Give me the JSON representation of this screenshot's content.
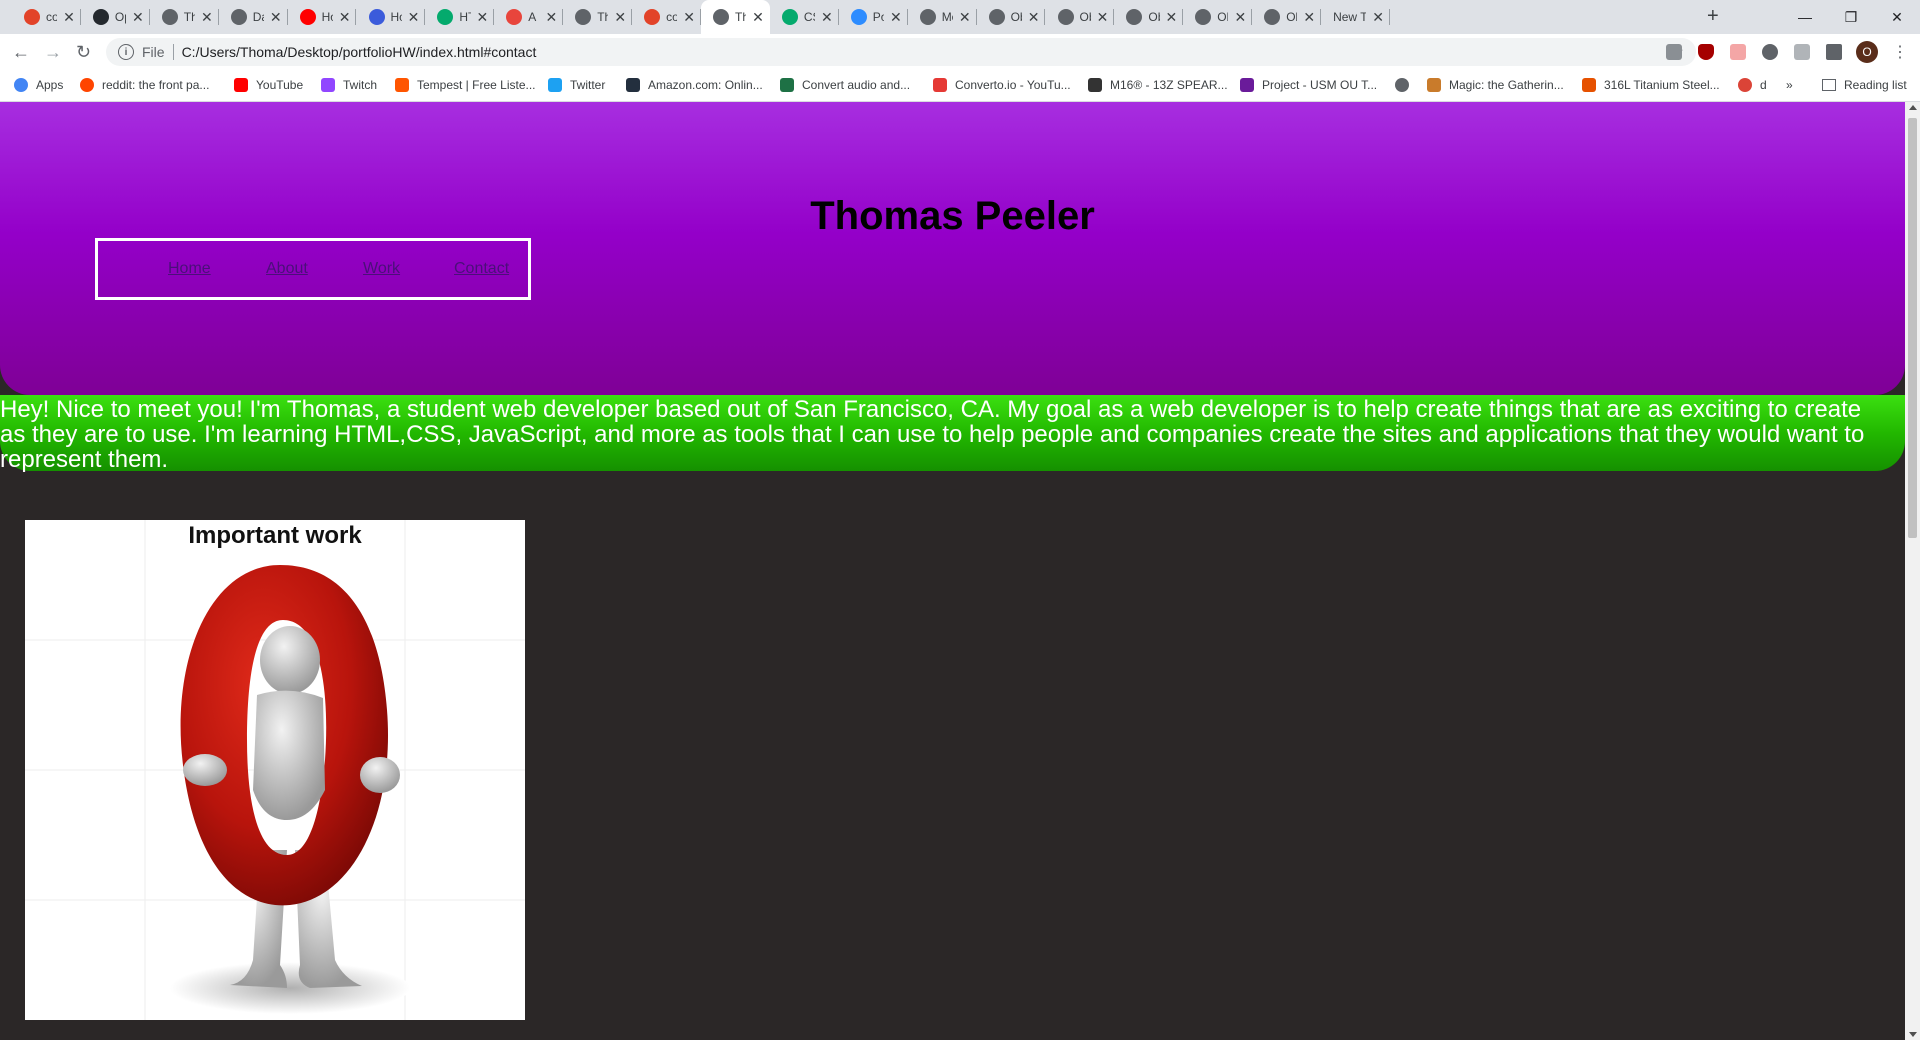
{
  "browser": {
    "tabs": [
      {
        "title": "cou",
        "icon": "gitlab-icon",
        "color": "#e24329"
      },
      {
        "title": "Opt",
        "icon": "github-icon",
        "color": "#24292e"
      },
      {
        "title": "Tho",
        "icon": "globe-icon",
        "color": "#5f6368"
      },
      {
        "title": "Das",
        "icon": "globe-icon",
        "color": "#5f6368"
      },
      {
        "title": "Hov",
        "icon": "youtube-icon",
        "color": "#ff0000"
      },
      {
        "title": "Hov",
        "icon": "docs-icon",
        "color": "#3b5bdb"
      },
      {
        "title": "HTN",
        "icon": "w3schools-icon",
        "color": "#04aa6d"
      },
      {
        "title": "A C",
        "icon": "asterisk-icon",
        "color": "#e8453c"
      },
      {
        "title": "Tho",
        "icon": "globe-icon",
        "color": "#5f6368"
      },
      {
        "title": "cou",
        "icon": "gitlab-icon",
        "color": "#e24329"
      },
      {
        "title": "Tho",
        "icon": "globe-icon",
        "color": "#5f6368",
        "active": true
      },
      {
        "title": "CSS",
        "icon": "w3schools-icon",
        "color": "#04aa6d"
      },
      {
        "title": "Pos",
        "icon": "zoom-icon",
        "color": "#2d8cff"
      },
      {
        "title": "Met",
        "icon": "globe-icon",
        "color": "#5f6368"
      },
      {
        "title": "Obj",
        "icon": "globe-icon",
        "color": "#5f6368"
      },
      {
        "title": "Obj",
        "icon": "globe-icon",
        "color": "#5f6368"
      },
      {
        "title": "Obj",
        "icon": "globe-icon",
        "color": "#5f6368"
      },
      {
        "title": "Obj",
        "icon": "globe-icon",
        "color": "#5f6368"
      },
      {
        "title": "Obj",
        "icon": "globe-icon",
        "color": "#5f6368"
      },
      {
        "title": "New Tal",
        "icon": "",
        "color": ""
      }
    ],
    "address": {
      "scheme": "File",
      "url": "C:/Users/Thoma/Desktop/portfolioHW/index.html#contact"
    },
    "profile_initial": "O",
    "bookmarks": [
      {
        "label": "Apps",
        "icon": "apps-grid-icon",
        "color": "#4285f4"
      },
      {
        "label": "reddit: the front pa...",
        "icon": "reddit-icon",
        "color": "#ff4500"
      },
      {
        "label": "YouTube",
        "icon": "youtube-icon",
        "color": "#ff0000"
      },
      {
        "label": "Twitch",
        "icon": "twitch-icon",
        "color": "#9146ff"
      },
      {
        "label": "Tempest | Free Liste...",
        "icon": "soundcloud-icon",
        "color": "#ff5500"
      },
      {
        "label": "Twitter",
        "icon": "twitter-icon",
        "color": "#1da1f2"
      },
      {
        "label": "Amazon.com: Onlin...",
        "icon": "amazon-icon",
        "color": "#232f3e"
      },
      {
        "label": "Convert audio and...",
        "icon": "convert-icon",
        "color": "#1e7145"
      },
      {
        "label": "Converto.io - YouTu...",
        "icon": "converto-icon",
        "color": "#e53935"
      },
      {
        "label": "M16® - 13Z SPEAR...",
        "icon": "crkt-icon",
        "color": "#333333"
      },
      {
        "label": "Project - USM OU T...",
        "icon": "project-icon",
        "color": "#6a1b9a"
      },
      {
        "label": "",
        "icon": "globe-icon",
        "color": "#5f6368"
      },
      {
        "label": "Magic: the Gatherin...",
        "icon": "magic-icon",
        "color": "#c97b2b"
      },
      {
        "label": "316L Titanium Steel...",
        "icon": "shop-icon",
        "color": "#e65100"
      },
      {
        "label": "d",
        "icon": "chrome-icon",
        "color": "#db4437"
      }
    ],
    "bookmarks_overflow": "»",
    "reading_list": "Reading list"
  },
  "page": {
    "title": "Thomas Peeler",
    "nav": [
      "Home",
      "About",
      "Work",
      "Contact"
    ],
    "intro": "Hey! Nice to meet you! I'm Thomas, a student web developer based out of San Francisco, CA. My goal as a web developer is to help create things that are as exciting to create as they are to use. I'm learning HTML,CSS, JavaScript, and more as tools that I can use to help people and companies create the sites and applications that they would want to represent them.",
    "card_title": "Important work",
    "colors": {
      "header_top": "#a72ee0",
      "header_bottom": "#7f0096",
      "intro_top": "#3be010",
      "intro_bottom": "#159000",
      "page_bg": "#2b2727"
    }
  }
}
